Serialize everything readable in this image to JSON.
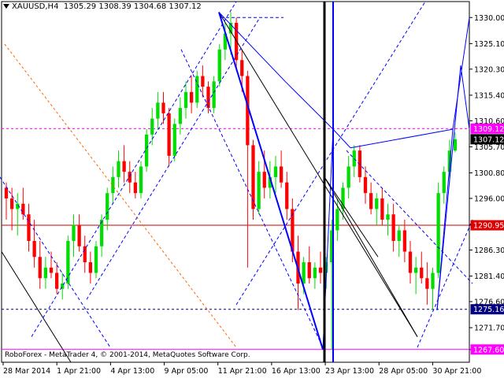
{
  "header": {
    "symbol_tf": "XAUUSD,H4",
    "ohlc": "1305.29 1308.39 1304.68 1307.12"
  },
  "copyright": "RoboForex - MetaTrader 4, © 2001-2014, MetaQuotes Software Corp.",
  "colors": {
    "background": "#ffffff",
    "bull": "#00dd00",
    "bear": "#ff0000",
    "line": "#0000ff",
    "hline_red": "#cc0000",
    "hline_magenta": "#ff00ff",
    "orange": "#ff6600"
  },
  "chart_data": {
    "type": "candlestick",
    "ylim": [
      1267.6,
      1333
    ],
    "y_ticks": [
      1330.0,
      1325.1,
      1320.3,
      1315.4,
      1310.6,
      1305.7,
      1300.8,
      1296.0,
      1291.1,
      1286.3,
      1281.4,
      1276.6,
      1271.7,
      1267.6
    ],
    "y_tick_labels": [
      "1330.00",
      "1325.10",
      "1320.30",
      "1315.40",
      "1310.60",
      "1305.70",
      "1300.80",
      "1296.00",
      "1291.10",
      "1286.30",
      "1281.40",
      "1276.60",
      "1271.70",
      "1267.60"
    ],
    "x_tick_labels": [
      "28 Mar 2014",
      "1 Apr 21:00",
      "4 Apr 13:00",
      "9 Apr 05:00",
      "11 Apr 21:00",
      "16 Apr 13:00",
      "23 Apr 13:00",
      "28 Apr 05:00",
      "30 Apr 21:00"
    ],
    "price_labels": [
      {
        "value": 1309.12,
        "text": "1309.12",
        "style": "magenta"
      },
      {
        "value": 1307.12,
        "text": "1307.12",
        "style": "current"
      },
      {
        "value": 1290.95,
        "text": "1290.95",
        "style": "red"
      },
      {
        "value": 1275.16,
        "text": "1275.16",
        "style": "blue"
      },
      {
        "value": 1267.6,
        "text": "1267.60",
        "style": "magenta"
      }
    ],
    "horizontal_lines": [
      {
        "value": 1309.12,
        "color": "#ff00ff",
        "dash": true
      },
      {
        "value": 1290.95,
        "color": "#cc0000",
        "dash": false
      },
      {
        "value": 1275.16,
        "color": "#000080",
        "dash": true
      },
      {
        "value": 1267.6,
        "color": "#ff00ff",
        "dash": false
      }
    ],
    "candles": [
      [
        1298,
        1299,
        1292,
        1296
      ],
      [
        1296,
        1298,
        1290,
        1294
      ],
      [
        1294,
        1297,
        1289,
        1295
      ],
      [
        1295,
        1298,
        1292,
        1293
      ],
      [
        1293,
        1295,
        1286,
        1288
      ],
      [
        1288,
        1292,
        1283,
        1285
      ],
      [
        1285,
        1288,
        1279,
        1281
      ],
      [
        1281,
        1285,
        1279,
        1283
      ],
      [
        1283,
        1286,
        1281,
        1282
      ],
      [
        1282,
        1284,
        1278,
        1279
      ],
      [
        1279,
        1282,
        1277,
        1280
      ],
      [
        1280,
        1289,
        1279,
        1288
      ],
      [
        1288,
        1293,
        1285,
        1291
      ],
      [
        1291,
        1293,
        1286,
        1287
      ],
      [
        1287,
        1289,
        1282,
        1284
      ],
      [
        1284,
        1286,
        1280,
        1282
      ],
      [
        1282,
        1288,
        1281,
        1287
      ],
      [
        1287,
        1293,
        1285,
        1292
      ],
      [
        1292,
        1298,
        1290,
        1297
      ],
      [
        1297,
        1302,
        1295,
        1300
      ],
      [
        1300,
        1305,
        1298,
        1303
      ],
      [
        1303,
        1306,
        1299,
        1301
      ],
      [
        1301,
        1303,
        1297,
        1299
      ],
      [
        1299,
        1301,
        1296,
        1297
      ],
      [
        1297,
        1303,
        1296,
        1302
      ],
      [
        1302,
        1309,
        1301,
        1308
      ],
      [
        1308,
        1313,
        1306,
        1311
      ],
      [
        1311,
        1316,
        1309,
        1314
      ],
      [
        1314,
        1316,
        1310,
        1312
      ],
      [
        1312,
        1313,
        1302,
        1304
      ],
      [
        1304,
        1311,
        1303,
        1310
      ],
      [
        1310,
        1315,
        1308,
        1313
      ],
      [
        1313,
        1318,
        1311,
        1316
      ],
      [
        1316,
        1319,
        1312,
        1314
      ],
      [
        1314,
        1320,
        1313,
        1319
      ],
      [
        1319,
        1321,
        1315,
        1317
      ],
      [
        1317,
        1318,
        1312,
        1313
      ],
      [
        1313,
        1319,
        1312,
        1318
      ],
      [
        1318,
        1325,
        1317,
        1324
      ],
      [
        1324,
        1329,
        1322,
        1327
      ],
      [
        1327,
        1331,
        1323,
        1329
      ],
      [
        1329,
        1330,
        1320,
        1322
      ],
      [
        1322,
        1324,
        1316,
        1319
      ],
      [
        1319,
        1320,
        1283,
        1306
      ],
      [
        1306,
        1307,
        1292,
        1294
      ],
      [
        1294,
        1303,
        1293,
        1301
      ],
      [
        1301,
        1305,
        1296,
        1298
      ],
      [
        1298,
        1303,
        1296,
        1300
      ],
      [
        1300,
        1304,
        1297,
        1302
      ],
      [
        1302,
        1305,
        1298,
        1299
      ],
      [
        1299,
        1301,
        1292,
        1294
      ],
      [
        1294,
        1296,
        1284,
        1286
      ],
      [
        1286,
        1289,
        1275,
        1280
      ],
      [
        1280,
        1285,
        1278,
        1284
      ],
      [
        1284,
        1287,
        1280,
        1281
      ],
      [
        1281,
        1284,
        1279,
        1283
      ],
      [
        1283,
        1286,
        1280,
        1282
      ],
      [
        1282,
        1285,
        1279,
        1284
      ],
      [
        1284,
        1292,
        1267.6,
        1290
      ],
      [
        1290,
        1296,
        1288,
        1294
      ],
      [
        1294,
        1299,
        1292,
        1298
      ],
      [
        1298,
        1304,
        1296,
        1302
      ],
      [
        1302,
        1306,
        1300,
        1305
      ],
      [
        1305,
        1306,
        1299,
        1300
      ],
      [
        1300,
        1302,
        1295,
        1297
      ],
      [
        1297,
        1299,
        1293,
        1294
      ],
      [
        1294,
        1297,
        1291,
        1296
      ],
      [
        1296,
        1298,
        1291,
        1292
      ],
      [
        1292,
        1295,
        1289,
        1293
      ],
      [
        1293,
        1295,
        1286,
        1288
      ],
      [
        1288,
        1291,
        1285,
        1290
      ],
      [
        1290,
        1292,
        1284,
        1286
      ],
      [
        1286,
        1288,
        1280,
        1282
      ],
      [
        1282,
        1285,
        1278,
        1283
      ],
      [
        1283,
        1286,
        1280,
        1281
      ],
      [
        1281,
        1284,
        1276,
        1279
      ],
      [
        1279,
        1283,
        1275,
        1282
      ],
      [
        1282,
        1299,
        1281,
        1297
      ],
      [
        1297,
        1302,
        1295,
        1301
      ],
      [
        1301,
        1307,
        1299,
        1305
      ],
      [
        1305,
        1308.39,
        1304.68,
        1307.12
      ]
    ]
  }
}
